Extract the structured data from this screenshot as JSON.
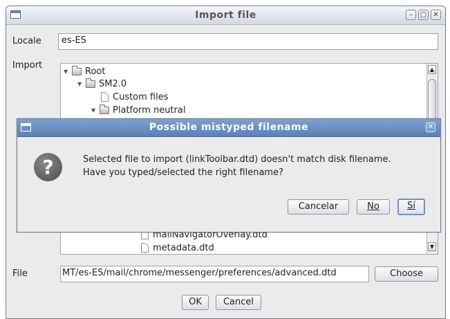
{
  "window": {
    "title": "Import file",
    "controls": [
      "minimize-icon",
      "maximize-icon",
      "close-icon"
    ]
  },
  "locale": {
    "label": "Locale",
    "value": "es-ES"
  },
  "import": {
    "label": "Import",
    "tree": [
      {
        "label": "Root",
        "type": "folder",
        "expanded": true
      },
      {
        "label": "SM2.0",
        "type": "folder",
        "expanded": true
      },
      {
        "label": "Custom files",
        "type": "file"
      },
      {
        "label": "Platform neutral",
        "type": "folder",
        "expanded": true
      },
      {
        "label": "mailNavigatorOverlay.dtd",
        "type": "file"
      },
      {
        "label": "metadata.dtd",
        "type": "file"
      }
    ]
  },
  "file": {
    "label": "File",
    "value": "МT/es-ES/mail/chrome/messenger/preferences/advanced.dtd",
    "choose_label": "Choose"
  },
  "buttons": {
    "ok": "OK",
    "cancel": "Cancel"
  },
  "dialog": {
    "title": "Possible mistyped filename",
    "message_line1": "Selected file to import (linkToolbar.dtd) doesn't match disk filename.",
    "message_line2": "Have you typed/selected the right filename?",
    "cancel_label": "Cancelar",
    "no_label": "No",
    "yes_label": "Sí"
  }
}
